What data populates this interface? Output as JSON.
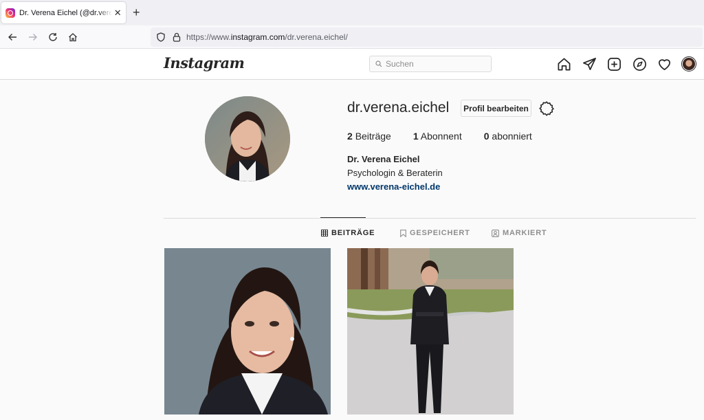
{
  "browser": {
    "tab_title": "Dr. Verena Eichel (@dr.verena.eichel)",
    "close_glyph": "✕",
    "newtab_glyph": "+",
    "url_prefix": "https://www.",
    "url_domain": "instagram.com",
    "url_path": "/dr.verena.eichel/",
    "icons": [
      "back-arrow-icon",
      "forward-arrow-icon",
      "reload-icon",
      "home-icon",
      "shield-icon",
      "lock-icon"
    ]
  },
  "header": {
    "logo": "Instagram",
    "search_placeholder": "Suchen",
    "icons": [
      "home-icon",
      "direct-icon",
      "new-post-icon",
      "explore-icon",
      "activity-heart-icon",
      "profile-avatar"
    ]
  },
  "profile": {
    "username": "dr.verena.eichel",
    "edit_label": "Profil bearbeiten",
    "stats": [
      {
        "count": "2",
        "label": "Beiträge"
      },
      {
        "count": "1",
        "label": "Abonnent"
      },
      {
        "count": "0",
        "label": "abonniert"
      }
    ],
    "full_name": "Dr. Verena Eichel",
    "bio": "Psychologin & Beraterin",
    "website": "www.verena-eichel.de"
  },
  "tabs": [
    {
      "label": "BEITRÄGE",
      "active": true
    },
    {
      "label": "GESPEICHERT",
      "active": false
    },
    {
      "label": "MARKIERT",
      "active": false
    }
  ],
  "posts": [
    {
      "description": "portrait-photo"
    },
    {
      "description": "full-body-photo-outdoor"
    }
  ],
  "colors": {
    "link": "#00376b",
    "text": "#262626",
    "muted": "#8e8e8e",
    "border": "#dbdbdb"
  }
}
